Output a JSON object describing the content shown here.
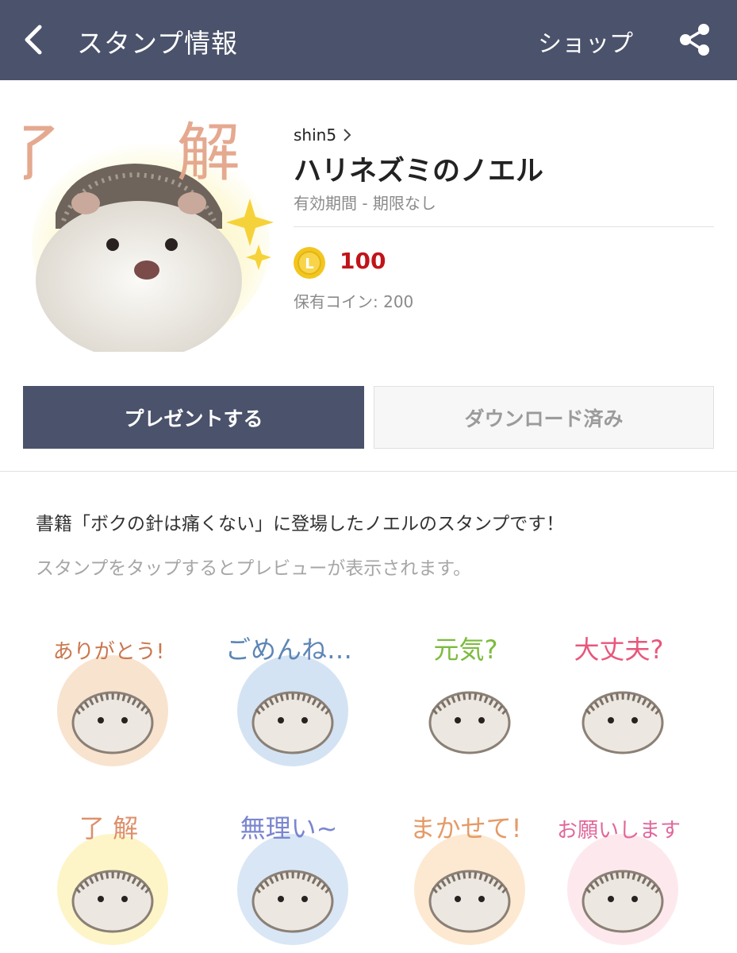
{
  "header": {
    "title": "スタンプ情報",
    "shop_label": "ショップ",
    "bg_color": "#4b526b"
  },
  "product": {
    "author": "shin5",
    "title": "ハリネズミのノエル",
    "validity": "有効期間 - 期限なし",
    "coin_letter": "L",
    "price": "100",
    "owned_coins": "保有コイン: 200",
    "price_color": "#c0141a",
    "main_sticker_text": "了 解"
  },
  "buttons": {
    "present": "プレゼントする",
    "download": "ダウンロード済み"
  },
  "description": {
    "text": "書籍「ボクの針は痛くない」に登場したノエルのスタンプです！",
    "hint": "スタンプをタップするとプレビューが表示されます。"
  },
  "stickers": [
    {
      "text": "ありがとう!",
      "color": "#c9774f"
    },
    {
      "text": "ごめんね…",
      "color": "#5d86b5"
    },
    {
      "text": "元気?",
      "color": "#7dbb3e"
    },
    {
      "text": "大丈夫?",
      "color": "#e8577b"
    },
    {
      "text": "了 解",
      "color": "#dd8f6a"
    },
    {
      "text": "無理い~",
      "color": "#7a86cf"
    },
    {
      "text": "まかせて!",
      "color": "#e49b67"
    },
    {
      "text": "お願いします",
      "color": "#e0679b"
    }
  ]
}
